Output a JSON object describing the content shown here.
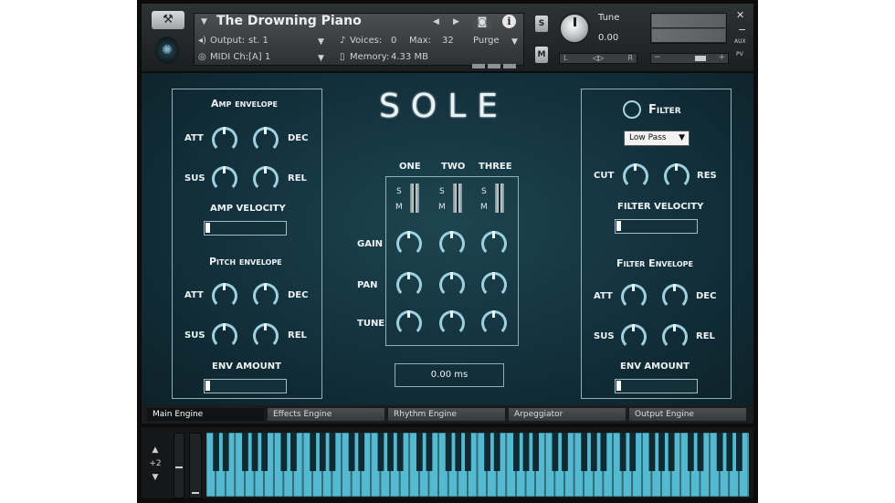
{
  "header": {
    "instrument_name": "The Drowning Piano",
    "output_label": "Output:",
    "output_value": "st. 1",
    "voices_label": "Voices:",
    "voices_value": "0",
    "max_label": "Max:",
    "max_value": "32",
    "purge_label": "Purge",
    "midi_label": "MIDI Ch:",
    "midi_value": "[A]  1",
    "memory_label": "Memory:",
    "memory_value": "4.33 MB",
    "tune_label": "Tune",
    "tune_value": "0.00",
    "solo_label": "S",
    "mute_label": "M",
    "pan_left": "L",
    "pan_center": "◁▷",
    "pan_right": "R",
    "vol_minus": "−",
    "vol_plus": "+",
    "aux_label": "AUX",
    "pv_label": "PV",
    "close_symbol": "✕",
    "minimize_symbol": "−"
  },
  "logo_text": "SOLE",
  "amp_envelope": {
    "title": "Amp envelope",
    "att": "ATT",
    "dec": "DEC",
    "sus": "SUS",
    "rel": "REL",
    "velocity_label": "AMP VELOCITY"
  },
  "pitch_envelope": {
    "title": "Pitch envelope",
    "att": "ATT",
    "dec": "DEC",
    "sus": "SUS",
    "rel": "REL",
    "amount_label": "ENV AMOUNT"
  },
  "mixer": {
    "channels": [
      "ONE",
      "TWO",
      "THREE"
    ],
    "solo": "S",
    "mute": "M",
    "gain_label": "GAIN",
    "pan_label": "PAN",
    "tune_label": "TUNE",
    "time_value": "0.00 ms"
  },
  "filter": {
    "title": "Filter",
    "type": "Low Pass",
    "cut": "CUT",
    "res": "RES",
    "velocity_label": "FILTER VELOCITY"
  },
  "filter_envelope": {
    "title": "Filter Envelope",
    "att": "ATT",
    "dec": "DEC",
    "sus": "SUS",
    "rel": "REL",
    "amount_label": "ENV AMOUNT"
  },
  "tabs": [
    "Main Engine",
    "Effects Engine",
    "Rhythm Engine",
    "Arpeggiator",
    "Output Engine"
  ],
  "keyboard": {
    "octave_value": "+2",
    "octave_up": "▲",
    "octave_down": "▼"
  },
  "colors": {
    "accent": "#9ed0e0",
    "keys": "#55b9cf",
    "panel_bg": "#143440"
  }
}
